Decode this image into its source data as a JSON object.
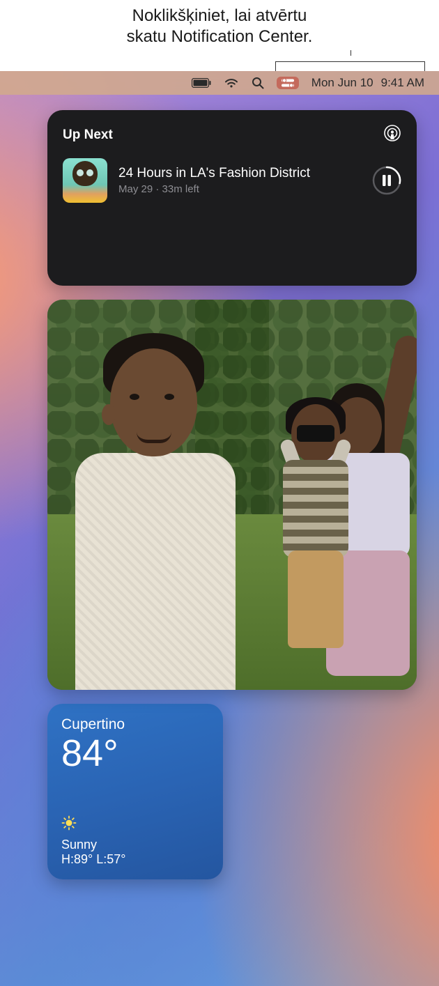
{
  "callout": {
    "line1": "Noklikšķiniet, lai atvērtu",
    "line2": "skatu Notification Center."
  },
  "menubar": {
    "date": "Mon Jun 10",
    "time": "9:41 AM"
  },
  "podcast": {
    "header": "Up Next",
    "episode_title": "24 Hours in LA's Fashion District",
    "meta": "May 29 · 33m left"
  },
  "weather": {
    "city": "Cupertino",
    "temp": "84°",
    "condition": "Sunny",
    "hilo": "H:89° L:57°"
  }
}
